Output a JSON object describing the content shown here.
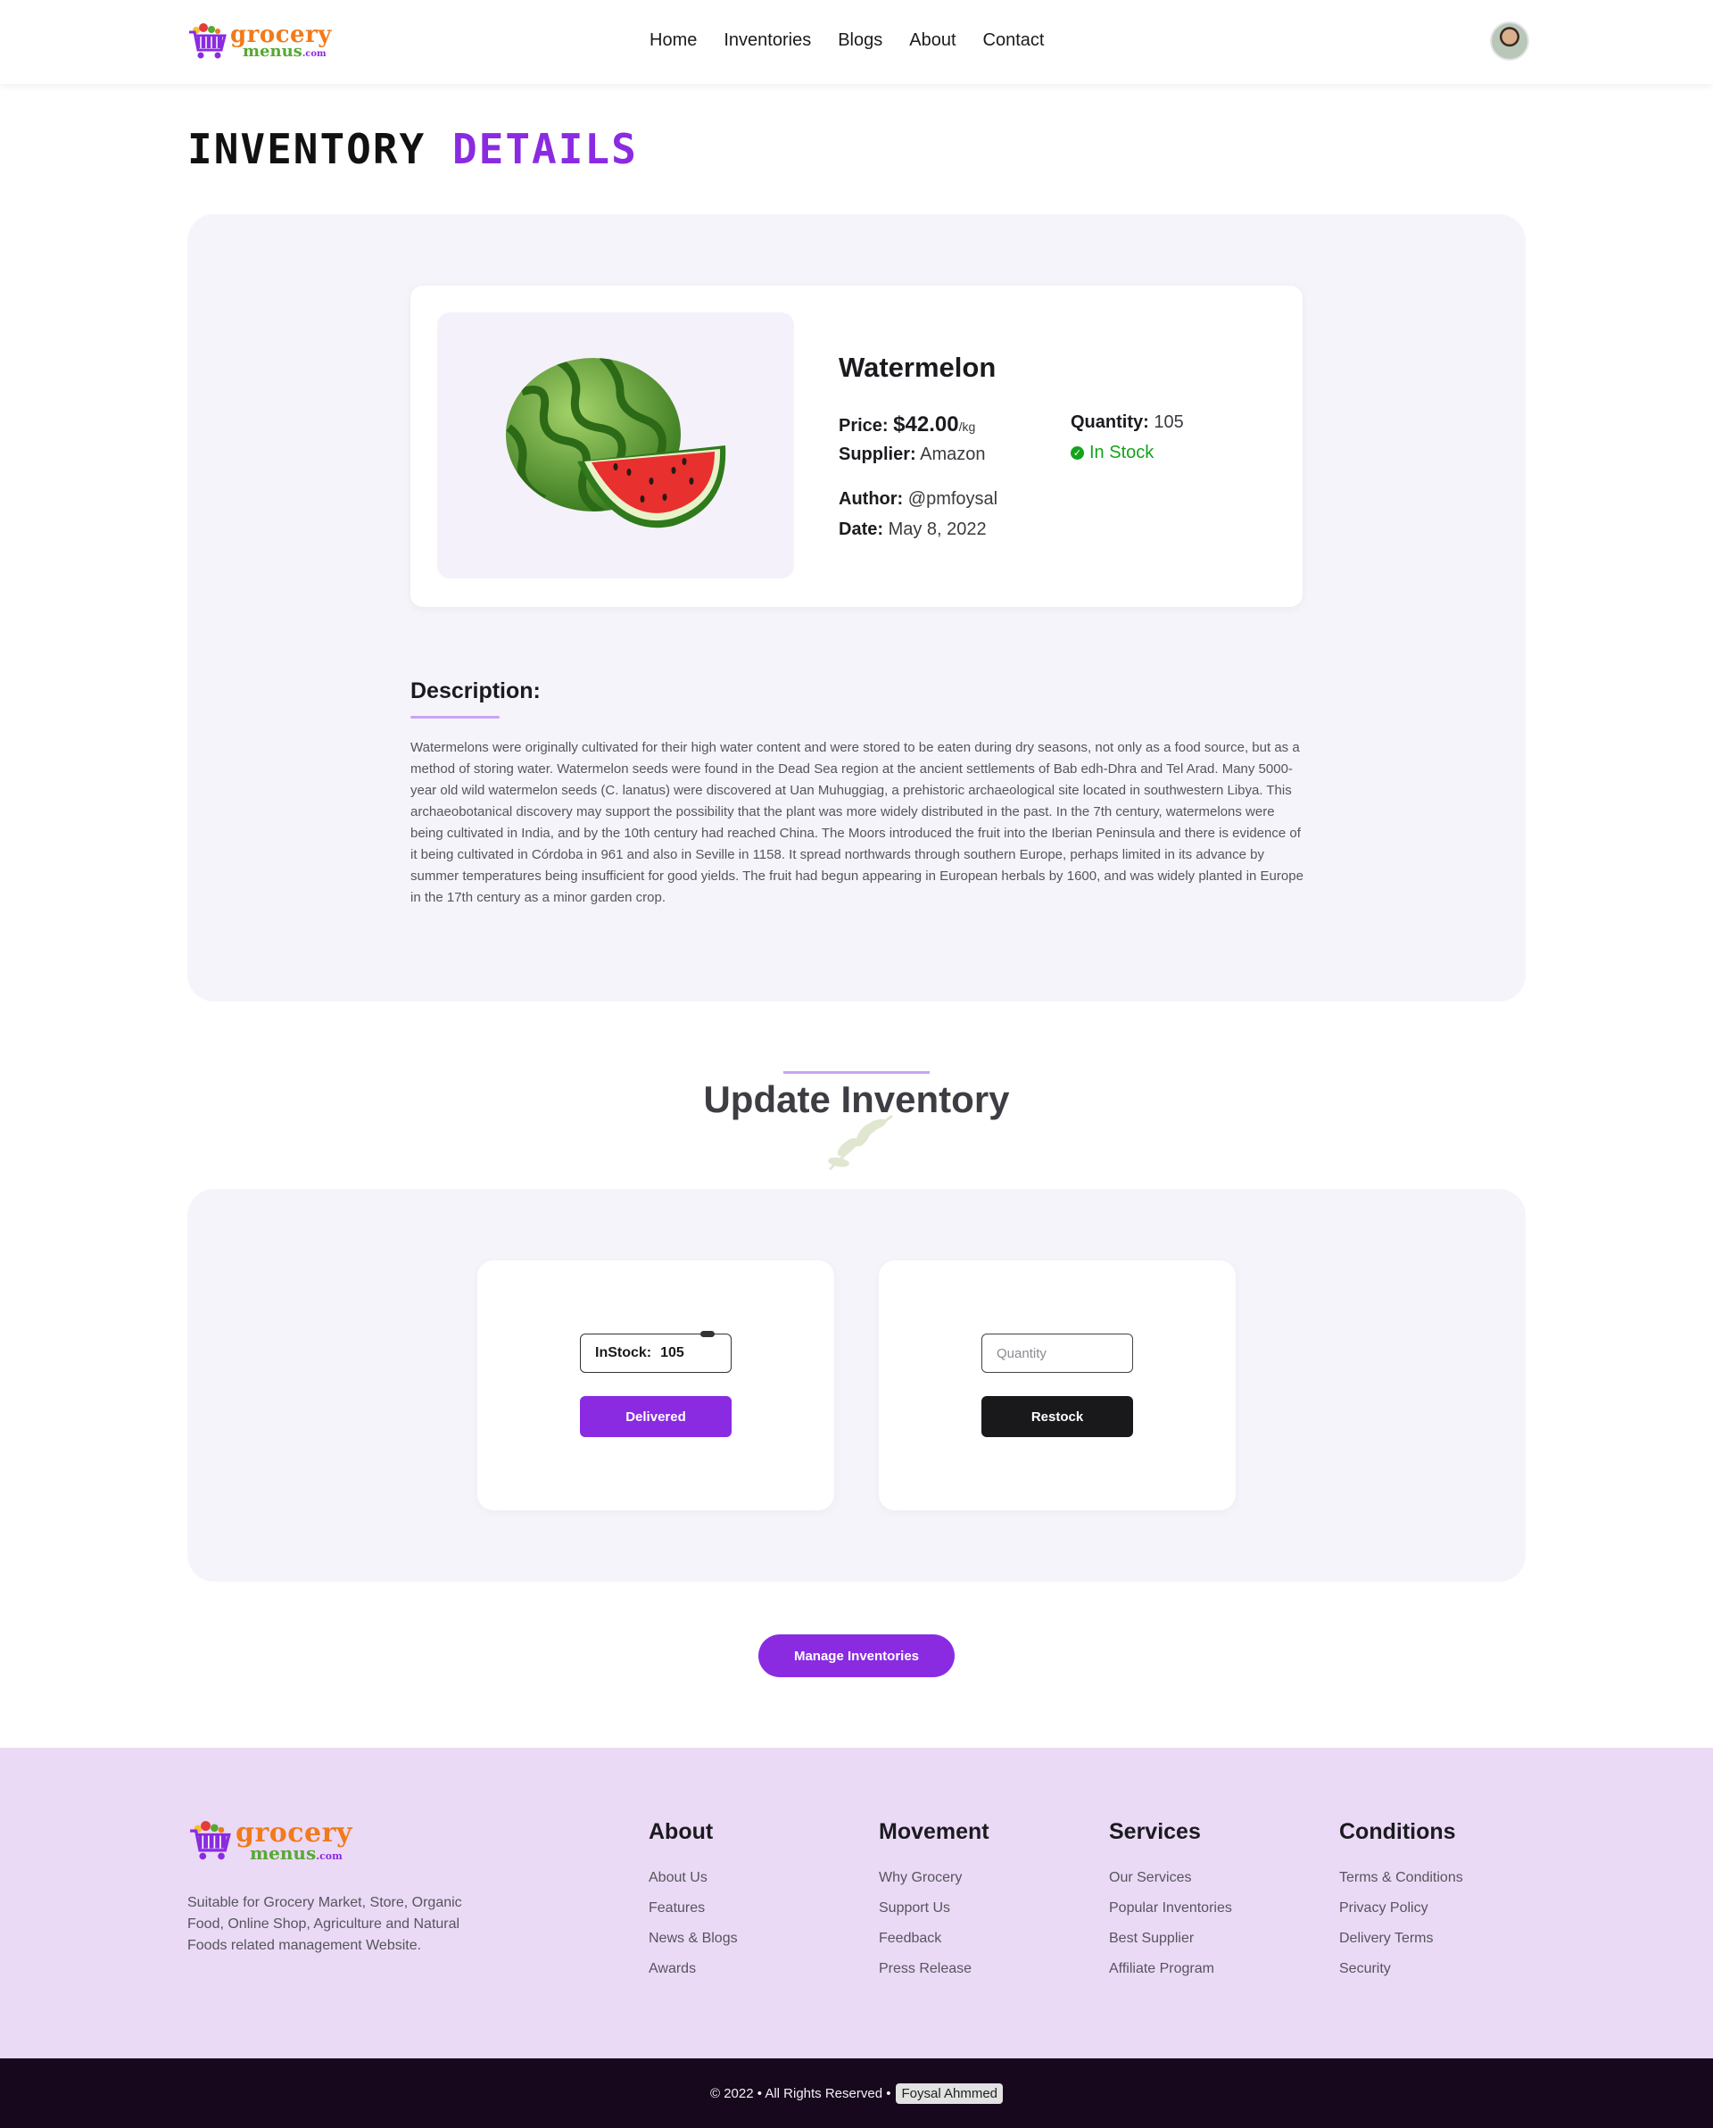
{
  "brand": {
    "word1": "grocery",
    "word2": "menus",
    "suffix": ".com"
  },
  "nav": {
    "items": [
      "Home",
      "Inventories",
      "Blogs",
      "About",
      "Contact"
    ]
  },
  "page_title": {
    "main": "INVENTORY",
    "accent": "DETAILS"
  },
  "product": {
    "name": "Watermelon",
    "price_label": "Price:",
    "price_value": "$42.00",
    "price_unit": "/kg",
    "quantity_label": "Quantity:",
    "quantity_value": "105",
    "supplier_label": "Supplier:",
    "supplier_value": "Amazon",
    "stock_status": "In Stock",
    "author_label": "Author:",
    "author_value": "@pmfoysal",
    "date_label": "Date:",
    "date_value": "May 8, 2022"
  },
  "description": {
    "title": "Description:",
    "text": "Watermelons were originally cultivated for their high water content and were stored to be eaten during dry seasons, not only as a food source, but as a method of storing water. Watermelon seeds were found in the Dead Sea region at the ancient settlements of Bab edh-Dhra and Tel Arad. Many 5000-year old wild watermelon seeds (C. lanatus) were discovered at Uan Muhuggiag, a prehistoric archaeological site located in southwestern Libya. This archaeobotanical discovery may support the possibility that the plant was more widely distributed in the past. In the 7th century, watermelons were being cultivated in India, and by the 10th century had reached China. The Moors introduced the fruit into the Iberian Peninsula and there is evidence of it being cultivated in Córdoba in 961 and also in Seville in 1158. It spread northwards through southern Europe, perhaps limited in its advance by summer temperatures being insufficient for good yields. The fruit had begun appearing in European herbals by 1600, and was widely planted in Europe in the 17th century as a minor garden crop."
  },
  "update_section": {
    "heading": "Update Inventory",
    "instock_label": "InStock:",
    "instock_value": "105",
    "deliver_button": "Delivered",
    "quantity_placeholder": "Quantity",
    "restock_button": "Restock"
  },
  "manage_button": "Manage Inventories",
  "footer": {
    "about_text": "Suitable for Grocery Market, Store, Organic Food, Online Shop, Agriculture and Natural Foods related management Website.",
    "columns": [
      {
        "title": "About",
        "links": [
          "About Us",
          "Features",
          "News & Blogs",
          "Awards"
        ]
      },
      {
        "title": "Movement",
        "links": [
          "Why Grocery",
          "Support Us",
          "Feedback",
          "Press Release"
        ]
      },
      {
        "title": "Services",
        "links": [
          "Our Services",
          "Popular Inventories",
          "Best Supplier",
          "Affiliate Program"
        ]
      },
      {
        "title": "Conditions",
        "links": [
          "Terms & Conditions",
          "Privacy Policy",
          "Delivery Terms",
          "Security"
        ]
      }
    ],
    "copyright": "© 2022 • All Rights Reserved •",
    "owner": "Foysal Ahmmed"
  },
  "colors": {
    "accent": "#8a2be2",
    "panel_bg": "#f6f4fb",
    "footer_bg": "#ebdaf6",
    "copyright_bg": "#17081e",
    "in_stock": "#15a31c"
  }
}
